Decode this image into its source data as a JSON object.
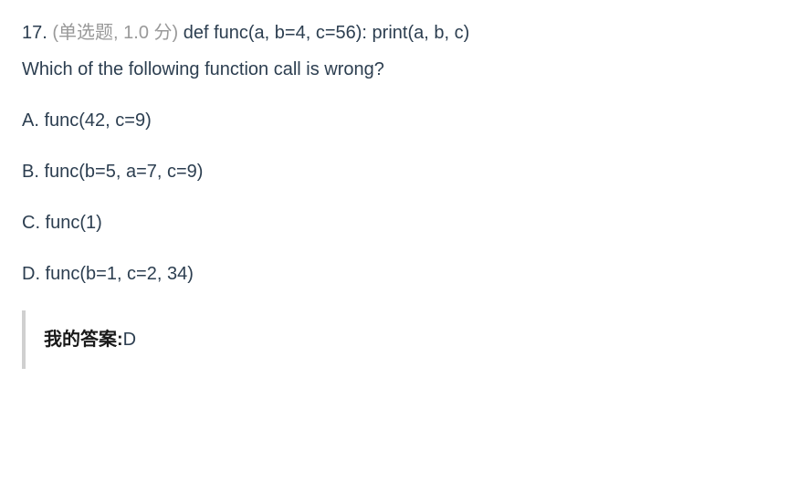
{
  "question": {
    "number": "17.",
    "meta": "(单选题, 1.0 分)",
    "code": "def func(a, b=4, c=56): print(a, b, c)",
    "prompt": "Which of the following function call is wrong?"
  },
  "options": [
    {
      "label": "A. func(42, c=9)"
    },
    {
      "label": "B. func(b=5, a=7, c=9)"
    },
    {
      "label": "C. func(1)"
    },
    {
      "label": "D. func(b=1, c=2, 34)"
    }
  ],
  "answer": {
    "label": "我的答案:",
    "value": "D"
  }
}
